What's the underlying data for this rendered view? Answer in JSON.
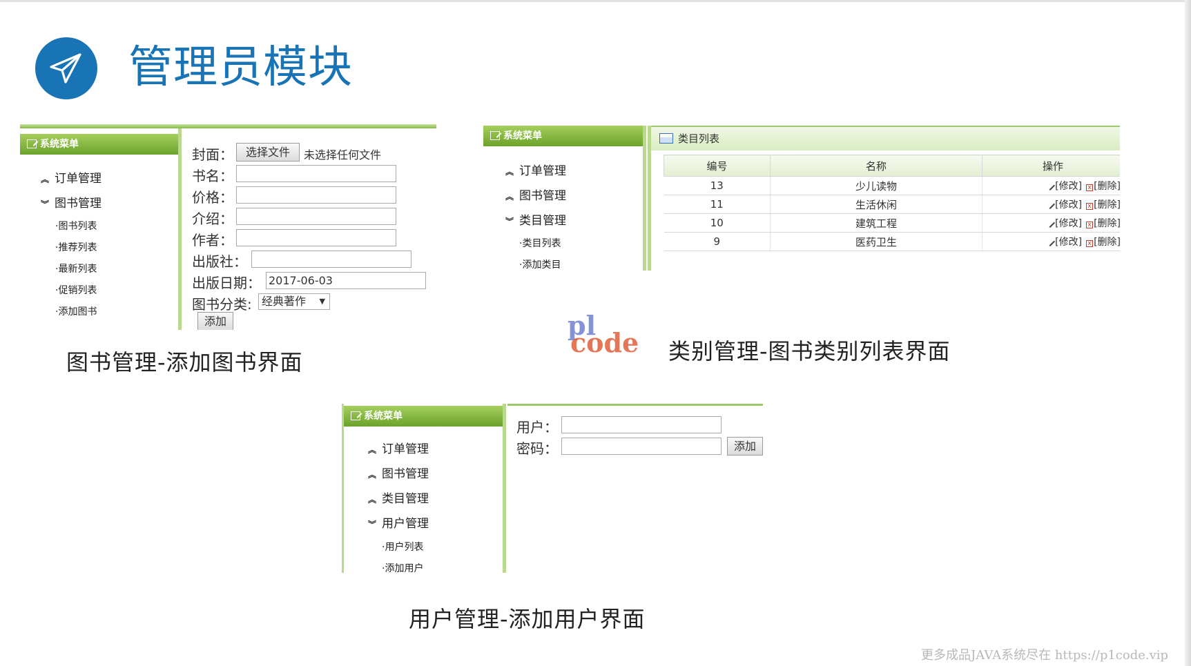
{
  "slide": {
    "title": "管理员模块"
  },
  "panel_books": {
    "menu_title": "系统菜单",
    "menu": [
      {
        "label": "订单管理",
        "state": "collapsed"
      },
      {
        "label": "图书管理",
        "state": "expanded"
      }
    ],
    "submenu": [
      "·图书列表",
      "·推荐列表",
      "·最新列表",
      "·促销列表",
      "·添加图书"
    ],
    "form": {
      "cover_label": "封面：",
      "choose_file_button": "选择文件",
      "no_file_text": "未选择任何文件",
      "name_label": "书名：",
      "price_label": "价格：",
      "intro_label": "介绍：",
      "author_label": "作者：",
      "publisher_label": "出版社：",
      "date_label": "出版日期：",
      "date_value": "2017-06-03",
      "category_label": "图书分类:",
      "category_value": "经典著作",
      "add_button": "添加"
    },
    "caption": "图书管理-添加图书界面"
  },
  "panel_categories": {
    "menu_title": "系统菜单",
    "menu": [
      {
        "label": "订单管理",
        "state": "collapsed"
      },
      {
        "label": "图书管理",
        "state": "collapsed"
      },
      {
        "label": "类目管理",
        "state": "expanded"
      }
    ],
    "submenu": [
      "·类目列表",
      "·添加类目"
    ],
    "list_title": "类目列表",
    "columns": [
      "编号",
      "名称",
      "操作"
    ],
    "rows": [
      {
        "id": "13",
        "name": "少儿读物",
        "edit": "[修改]",
        "delete": "[删除]"
      },
      {
        "id": "11",
        "name": "生活休闲",
        "edit": "[修改]",
        "delete": "[删除]"
      },
      {
        "id": "10",
        "name": "建筑工程",
        "edit": "[修改]",
        "delete": "[删除]"
      },
      {
        "id": "9",
        "name": "医药卫生",
        "edit": "[修改]",
        "delete": "[删除]"
      }
    ],
    "caption": "类别管理-图书类别列表界面"
  },
  "panel_users": {
    "menu_title": "系统菜单",
    "menu": [
      {
        "label": "订单管理",
        "state": "collapsed"
      },
      {
        "label": "图书管理",
        "state": "collapsed"
      },
      {
        "label": "类目管理",
        "state": "collapsed"
      },
      {
        "label": "用户管理",
        "state": "expanded"
      }
    ],
    "submenu": [
      "·用户列表",
      "·添加用户"
    ],
    "form": {
      "user_label": "用户：",
      "password_label": "密码：",
      "add_button": "添加"
    },
    "caption": "用户管理-添加用户界面"
  },
  "watermark": {
    "logo_top": "pl",
    "logo_bottom": "code",
    "footer": "更多成品JAVA系统尽在 https://p1code.vip"
  },
  "colors": {
    "title_blue": "#1874b4",
    "menu_green": "#6aa22b",
    "border_green": "#b9d98c"
  },
  "icons": {
    "logo": "paper-plane-icon",
    "menu_head": "edit-note-icon",
    "collapsed": "chevron-up-icon",
    "expanded": "chevron-down-icon",
    "list": "grid-list-icon",
    "edit": "pencil-icon",
    "delete": "delete-box-icon"
  }
}
